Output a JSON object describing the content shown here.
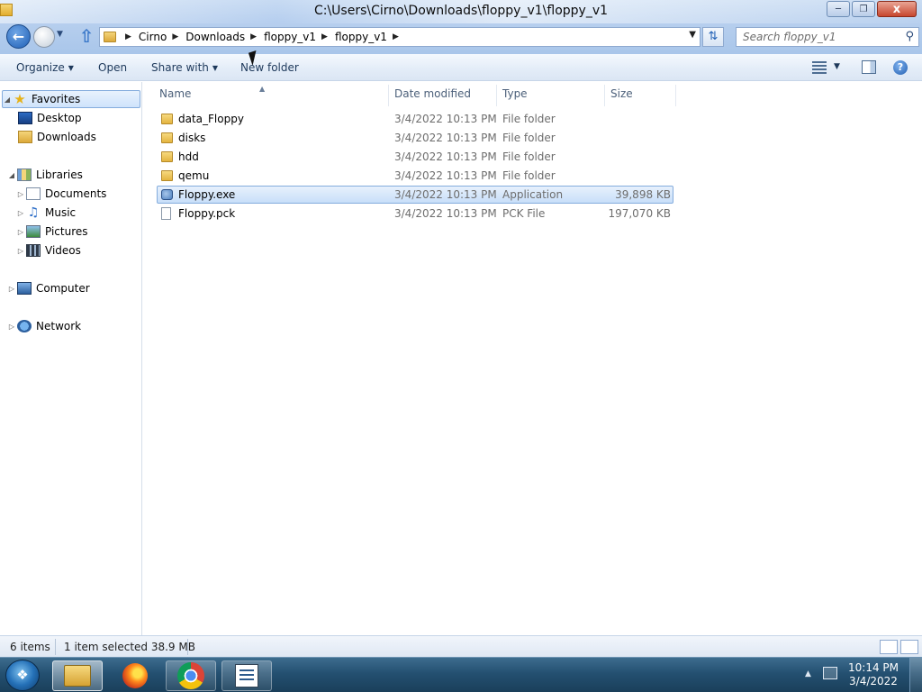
{
  "window": {
    "title": "C:\\Users\\Cirno\\Downloads\\floppy_v1\\floppy_v1",
    "minimize_icon": "minimize-icon",
    "maximize_icon": "restore-icon",
    "close_label": "x"
  },
  "address": {
    "breadcrumbs": [
      "Cirno",
      "Downloads",
      "floppy_v1",
      "floppy_v1"
    ]
  },
  "search": {
    "placeholder": "Search floppy_v1"
  },
  "toolbar": {
    "organize": "Organize",
    "open": "Open",
    "share_with": "Share with",
    "new_folder": "New folder"
  },
  "sidebar": {
    "favorites": "Favorites",
    "desktop": "Desktop",
    "downloads": "Downloads",
    "libraries": "Libraries",
    "documents": "Documents",
    "music": "Music",
    "pictures": "Pictures",
    "videos": "Videos",
    "computer": "Computer",
    "network": "Network"
  },
  "columns": {
    "name": "Name",
    "date": "Date modified",
    "type": "Type",
    "size": "Size"
  },
  "files": [
    {
      "name": "data_Floppy",
      "date": "3/4/2022 10:13 PM",
      "type": "File folder",
      "size": "",
      "icon": "folder-icon"
    },
    {
      "name": "disks",
      "date": "3/4/2022 10:13 PM",
      "type": "File folder",
      "size": "",
      "icon": "folder-icon"
    },
    {
      "name": "hdd",
      "date": "3/4/2022 10:13 PM",
      "type": "File folder",
      "size": "",
      "icon": "folder-icon"
    },
    {
      "name": "qemu",
      "date": "3/4/2022 10:13 PM",
      "type": "File folder",
      "size": "",
      "icon": "folder-icon"
    },
    {
      "name": "Floppy.exe",
      "date": "3/4/2022 10:13 PM",
      "type": "Application",
      "size": "39,898 KB",
      "icon": "application-icon"
    },
    {
      "name": "Floppy.pck",
      "date": "3/4/2022 10:13 PM",
      "type": "PCK File",
      "size": "197,070 KB",
      "icon": "file-icon"
    }
  ],
  "status": {
    "item_count": "6 items",
    "selection": "1 item selected  38.9 MB"
  },
  "taskbar": {
    "time": "10:14 PM",
    "date": "3/4/2022",
    "apps": [
      "windows-explorer-icon",
      "firefox-icon",
      "chrome-icon",
      "task-list-icon"
    ]
  },
  "colors": {
    "selection_fill": "#cfe3fb",
    "selection_border": "#84acdd",
    "taskbar": "#245071"
  }
}
